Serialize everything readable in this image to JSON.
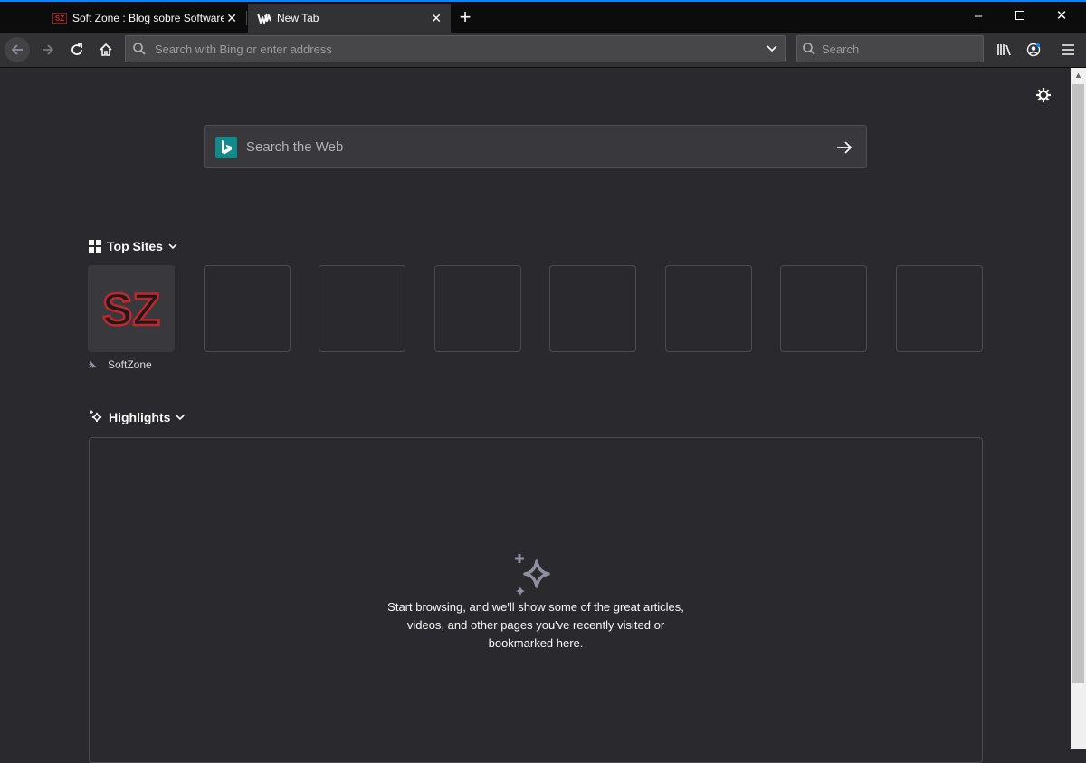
{
  "tabs": [
    {
      "title": "Soft Zone : Blog sobre Software",
      "favicon": "softzone-favicon",
      "active": false
    },
    {
      "title": "New Tab",
      "favicon": "firefox-new-tab-icon",
      "active": true
    }
  ],
  "toolbar": {
    "url_placeholder": "Search with Bing or enter address",
    "search_placeholder": "Search"
  },
  "page": {
    "websearch_placeholder": "Search the Web",
    "top_sites": {
      "title": "Top Sites",
      "sites": [
        {
          "label": "SoftZone",
          "logo_text": "SZ",
          "pinned": true
        }
      ]
    },
    "highlights": {
      "title": "Highlights",
      "empty_message": "Start browsing, and we'll show some of the great articles, videos, and other pages you've recently visited or bookmarked here."
    }
  },
  "colors": {
    "accent": "#0a84ff",
    "page_bg": "#2a2a2e",
    "bing": "#138a8a",
    "softzone_red": "#c0272d"
  }
}
